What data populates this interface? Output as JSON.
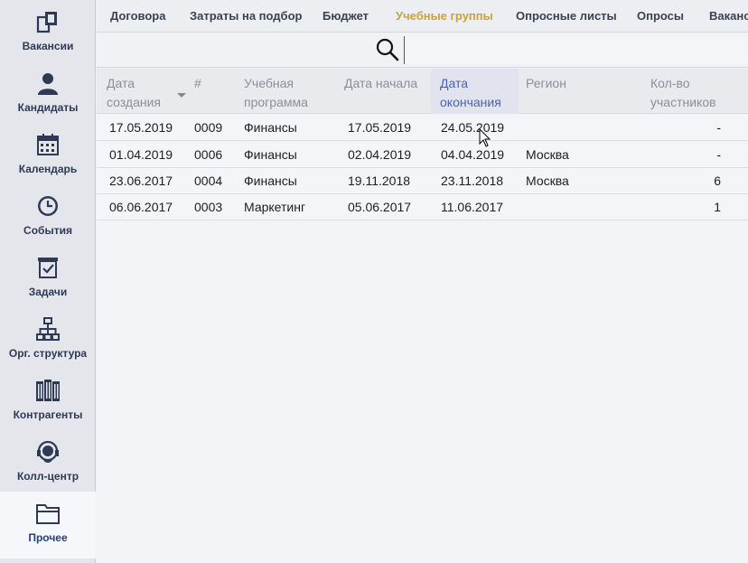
{
  "sidebar": {
    "items": [
      {
        "label": "Вакансии",
        "icon": "vacancies-icon"
      },
      {
        "label": "Кандидаты",
        "icon": "candidates-icon"
      },
      {
        "label": "Календарь",
        "icon": "calendar-icon"
      },
      {
        "label": "События",
        "icon": "clock-icon"
      },
      {
        "label": "Задачи",
        "icon": "tasks-icon"
      },
      {
        "label": "Орг. структура",
        "icon": "org-structure-icon"
      },
      {
        "label": "Контрагенты",
        "icon": "buildings-icon"
      },
      {
        "label": "Колл-центр",
        "icon": "call-center-icon"
      },
      {
        "label": "Прочее",
        "icon": "folder-icon"
      }
    ]
  },
  "tabs": [
    {
      "label": "Договора"
    },
    {
      "label": "Затраты на подбор"
    },
    {
      "label": "Бюджет"
    },
    {
      "label": "Учебные группы"
    },
    {
      "label": "Опросные листы"
    },
    {
      "label": "Опросы"
    },
    {
      "label": "Вакансии"
    }
  ],
  "search": {
    "value": "",
    "placeholder": ""
  },
  "table": {
    "headers": [
      {
        "line1": "Дата",
        "line2": "создания"
      },
      {
        "line1": "#",
        "line2": ""
      },
      {
        "line1": "Учебная",
        "line2": "программа"
      },
      {
        "line1": "Дата начала",
        "line2": ""
      },
      {
        "line1": "Дата",
        "line2": "окончания"
      },
      {
        "line1": "Регион",
        "line2": ""
      },
      {
        "line1": "Кол-во",
        "line2": "участников"
      }
    ],
    "rows": [
      {
        "created": "17.05.2019",
        "num": "0009",
        "program": "Финансы",
        "start": "17.05.2019",
        "end": "24.05.2019",
        "region": "",
        "count": "-"
      },
      {
        "created": "01.04.2019",
        "num": "0006",
        "program": "Финансы",
        "start": "02.04.2019",
        "end": "04.04.2019",
        "region": "Москва",
        "count": "-"
      },
      {
        "created": "23.06.2017",
        "num": "0004",
        "program": "Финансы",
        "start": "19.11.2018",
        "end": "23.11.2018",
        "region": "Москва",
        "count": "6"
      },
      {
        "created": "06.06.2017",
        "num": "0003",
        "program": "Маркетинг",
        "start": "05.06.2017",
        "end": "11.06.2017",
        "region": "",
        "count": "1"
      }
    ]
  },
  "colors": {
    "active_tab": "#c9a23a",
    "sorted_header": "#4b62b0",
    "sidebar_label": "#2e3a55"
  }
}
